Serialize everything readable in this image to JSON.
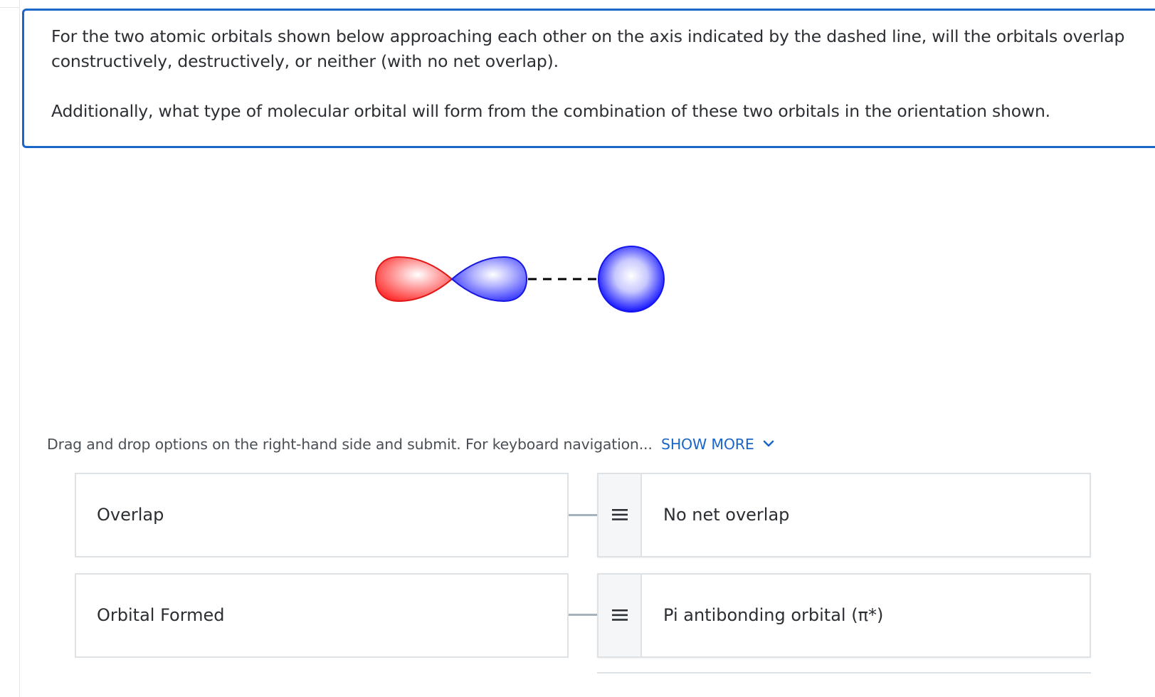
{
  "question": {
    "line1": "For the two atomic orbitals shown below approaching each other on the axis indicated by the dashed line, will the orbitals overlap",
    "line2": "constructively, destructively, or neither (with no net overlap).",
    "line3": "Additionally, what type of molecular orbital will form from the combination of these two orbitals in the orientation shown."
  },
  "figure": {
    "lobe_left_color": "#ff2a2a",
    "lobe_right_color": "#2a2aff",
    "sphere_color": "#1f1fff",
    "description_icon": "p-orbital-and-s-orbital"
  },
  "instructions": {
    "text": "Drag and drop options on the right-hand side and submit. For keyboard navigation...",
    "show_more": "SHOW MORE"
  },
  "targets": [
    {
      "label": "Overlap"
    },
    {
      "label": "Orbital Formed"
    }
  ],
  "options": [
    {
      "label": "No net overlap",
      "icon": "drag-handle-icon"
    },
    {
      "label": "Pi antibonding orbital (π*)",
      "icon": "drag-handle-icon"
    }
  ],
  "colors": {
    "accent": "#1b66c9",
    "border": "#dfe2e5",
    "connector": "#a7b3bc"
  }
}
